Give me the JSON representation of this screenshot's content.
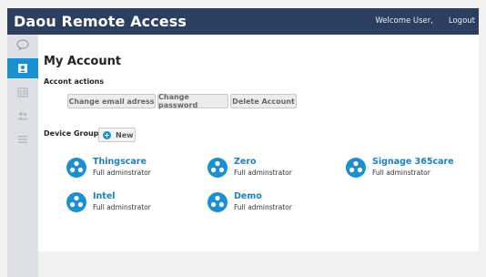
{
  "header": {
    "app_title": "Daou Remote Access",
    "welcome_text": "Welcome User,",
    "logout_label": "Logout"
  },
  "sidebar": {
    "items": [
      {
        "icon": "chat-bubble-icon",
        "active": false
      },
      {
        "icon": "user-card-icon",
        "active": true
      },
      {
        "icon": "calendar-icon",
        "active": false
      },
      {
        "icon": "users-icon",
        "active": false
      },
      {
        "icon": "menu-lines-icon",
        "active": false
      }
    ]
  },
  "main": {
    "title": "My Account",
    "account_actions": {
      "label": "Accont actions",
      "buttons": [
        "Change email adress",
        "Change password",
        "Delete Account"
      ]
    },
    "device_groups": {
      "label": "Device Groups",
      "new_label": "New",
      "groups": [
        {
          "name": "Thingscare",
          "role": "Full adminstrator"
        },
        {
          "name": "Zero",
          "role": "Full adminstrator"
        },
        {
          "name": "Signage 365care",
          "role": "Full adminstrator"
        },
        {
          "name": "Intel",
          "role": "Full adminstrator"
        },
        {
          "name": "Demo",
          "role": "Full adminstrator"
        }
      ]
    }
  },
  "colors": {
    "header_bg": "#2d3f5e",
    "accent": "#1c8fd0",
    "link": "#1c7fc4",
    "sidebar_bg": "#dde0e4"
  }
}
